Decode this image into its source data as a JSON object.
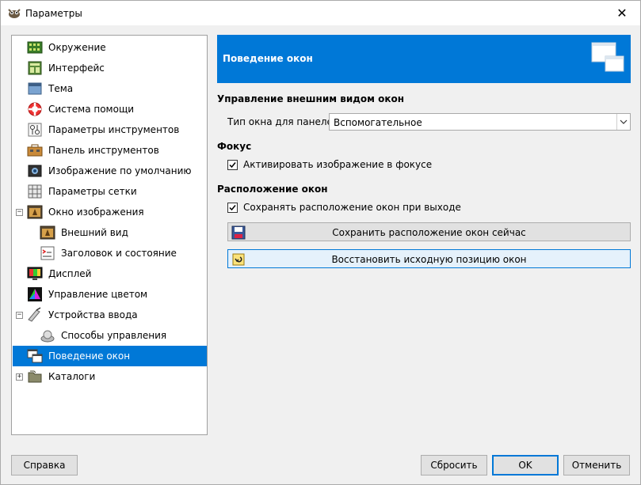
{
  "window": {
    "title": "Параметры",
    "close_glyph": "✕"
  },
  "tree": {
    "items": [
      {
        "label": "Окружение",
        "icon": "environment-icon"
      },
      {
        "label": "Интерфейс",
        "icon": "interface-icon"
      },
      {
        "label": "Тема",
        "icon": "theme-icon"
      },
      {
        "label": "Система помощи",
        "icon": "help-system-icon"
      },
      {
        "label": "Параметры инструментов",
        "icon": "tool-options-icon"
      },
      {
        "label": "Панель инструментов",
        "icon": "toolbox-icon"
      },
      {
        "label": "Изображение по умолчанию",
        "icon": "default-image-icon"
      },
      {
        "label": "Параметры сетки",
        "icon": "grid-icon"
      },
      {
        "label": "Окно изображения",
        "icon": "image-window-icon",
        "expander": "⊟"
      },
      {
        "label": "Внешний вид",
        "icon": "appearance-icon"
      },
      {
        "label": "Заголовок и состояние",
        "icon": "title-status-icon"
      },
      {
        "label": "Дисплей",
        "icon": "display-icon"
      },
      {
        "label": "Управление цветом",
        "icon": "color-management-icon"
      },
      {
        "label": "Устройства ввода",
        "icon": "input-devices-icon",
        "expander": "⊟"
      },
      {
        "label": "Способы управления",
        "icon": "input-controllers-icon"
      },
      {
        "label": "Поведение окон",
        "icon": "window-management-icon",
        "selected": true
      },
      {
        "label": "Каталоги",
        "icon": "folders-icon",
        "expander": "⊞"
      }
    ]
  },
  "header": {
    "title": "Поведение окон"
  },
  "sections": {
    "appearance_title": "Управление внешним видом окон",
    "hint_label": "Тип окна для панелей:",
    "hint_value": "Вспомогательное",
    "focus_title": "Фокус",
    "focus_check_label": "Активировать изображение в фокусе",
    "focus_checked": true,
    "positions_title": "Расположение окон",
    "save_check_label": "Сохранять расположение окон при выходе",
    "save_checked": true,
    "save_now_label": "Сохранить расположение окон сейчас",
    "reset_label": "Восстановить исходную позицию окон"
  },
  "buttons": {
    "help": "Справка",
    "reset": "Сбросить",
    "ok": "OK",
    "cancel": "Отменить"
  },
  "colors": {
    "accent": "#0078d7",
    "selection_text": "#ffffff"
  }
}
